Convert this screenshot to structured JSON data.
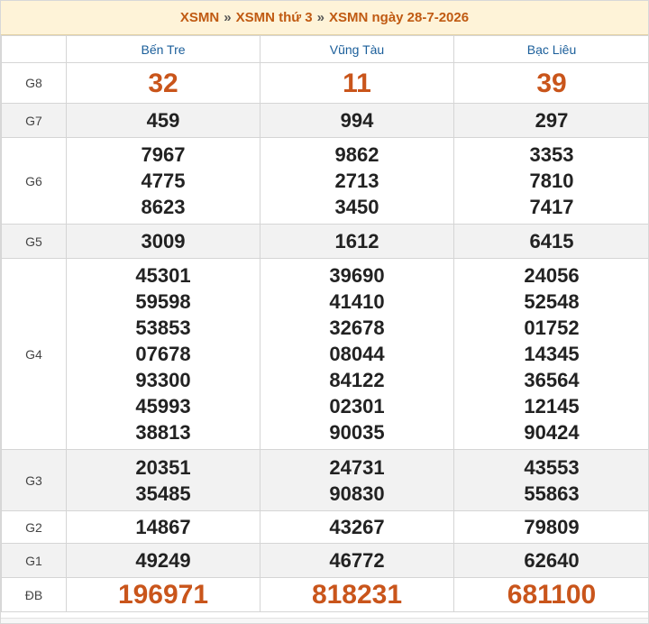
{
  "header": {
    "crumb1": "XSMN",
    "crumb2": "XSMN thứ 3",
    "crumb3": "XSMN ngày 28-7-2026",
    "separator": "»"
  },
  "provinces": [
    "Bến Tre",
    "Vũng Tàu",
    "Bạc Liêu"
  ],
  "prizes": [
    {
      "label": "G8",
      "values": [
        [
          "32"
        ],
        [
          "11"
        ],
        [
          "39"
        ]
      ]
    },
    {
      "label": "G7",
      "values": [
        [
          "459"
        ],
        [
          "994"
        ],
        [
          "297"
        ]
      ]
    },
    {
      "label": "G6",
      "values": [
        [
          "7967",
          "4775",
          "8623"
        ],
        [
          "9862",
          "2713",
          "3450"
        ],
        [
          "3353",
          "7810",
          "7417"
        ]
      ]
    },
    {
      "label": "G5",
      "values": [
        [
          "3009"
        ],
        [
          "1612"
        ],
        [
          "6415"
        ]
      ]
    },
    {
      "label": "G4",
      "values": [
        [
          "45301",
          "59598",
          "53853",
          "07678",
          "93300",
          "45993",
          "38813"
        ],
        [
          "39690",
          "41410",
          "32678",
          "08044",
          "84122",
          "02301",
          "90035"
        ],
        [
          "24056",
          "52548",
          "01752",
          "14345",
          "36564",
          "12145",
          "90424"
        ]
      ]
    },
    {
      "label": "G3",
      "values": [
        [
          "20351",
          "35485"
        ],
        [
          "24731",
          "90830"
        ],
        [
          "43553",
          "55863"
        ]
      ]
    },
    {
      "label": "G2",
      "values": [
        [
          "14867"
        ],
        [
          "43267"
        ],
        [
          "79809"
        ]
      ]
    },
    {
      "label": "G1",
      "values": [
        [
          "49249"
        ],
        [
          "46772"
        ],
        [
          "62640"
        ]
      ]
    },
    {
      "label": "ĐB",
      "values": [
        [
          "196971"
        ],
        [
          "818231"
        ],
        [
          "681100"
        ]
      ]
    }
  ],
  "colors": {
    "accent": "#c9551b",
    "header_bg": "#fef3d8",
    "province": "#1a5e9a"
  }
}
